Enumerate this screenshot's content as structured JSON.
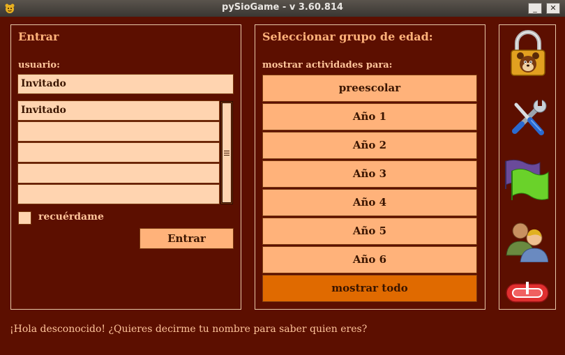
{
  "window": {
    "title": "pySioGame - v 3.60.814",
    "minimize_label": "_",
    "close_label": "✕"
  },
  "login": {
    "title": "Entrar",
    "user_label": "usuario:",
    "user_value": "Invitado",
    "users": [
      "Invitado",
      "",
      "",
      "",
      ""
    ],
    "remember_label": "recuérdame",
    "remember_checked": false,
    "submit_label": "Entrar"
  },
  "age_group": {
    "title": "Seleccionar grupo de edad:",
    "subtitle": "mostrar actividades para:",
    "options": [
      "preescolar",
      "Año 1",
      "Año 2",
      "Año 3",
      "Año 4",
      "Año 5",
      "Año 6"
    ],
    "show_all_label": "mostrar todo"
  },
  "sidebar": {
    "icons": [
      "lock-icon",
      "settings-tools-icon",
      "language-flag-icon",
      "users-icon",
      "exit-icon"
    ]
  },
  "colors": {
    "background": "#5c0f00",
    "panel_border": "#e9c8a8",
    "button": "#ffb27a",
    "button_active": "#e06a00",
    "field": "#ffd4b0",
    "title_text": "#ffb27a"
  },
  "status_message": "¡Hola desconocido! ¿Quieres decirme tu nombre para saber quien eres?"
}
